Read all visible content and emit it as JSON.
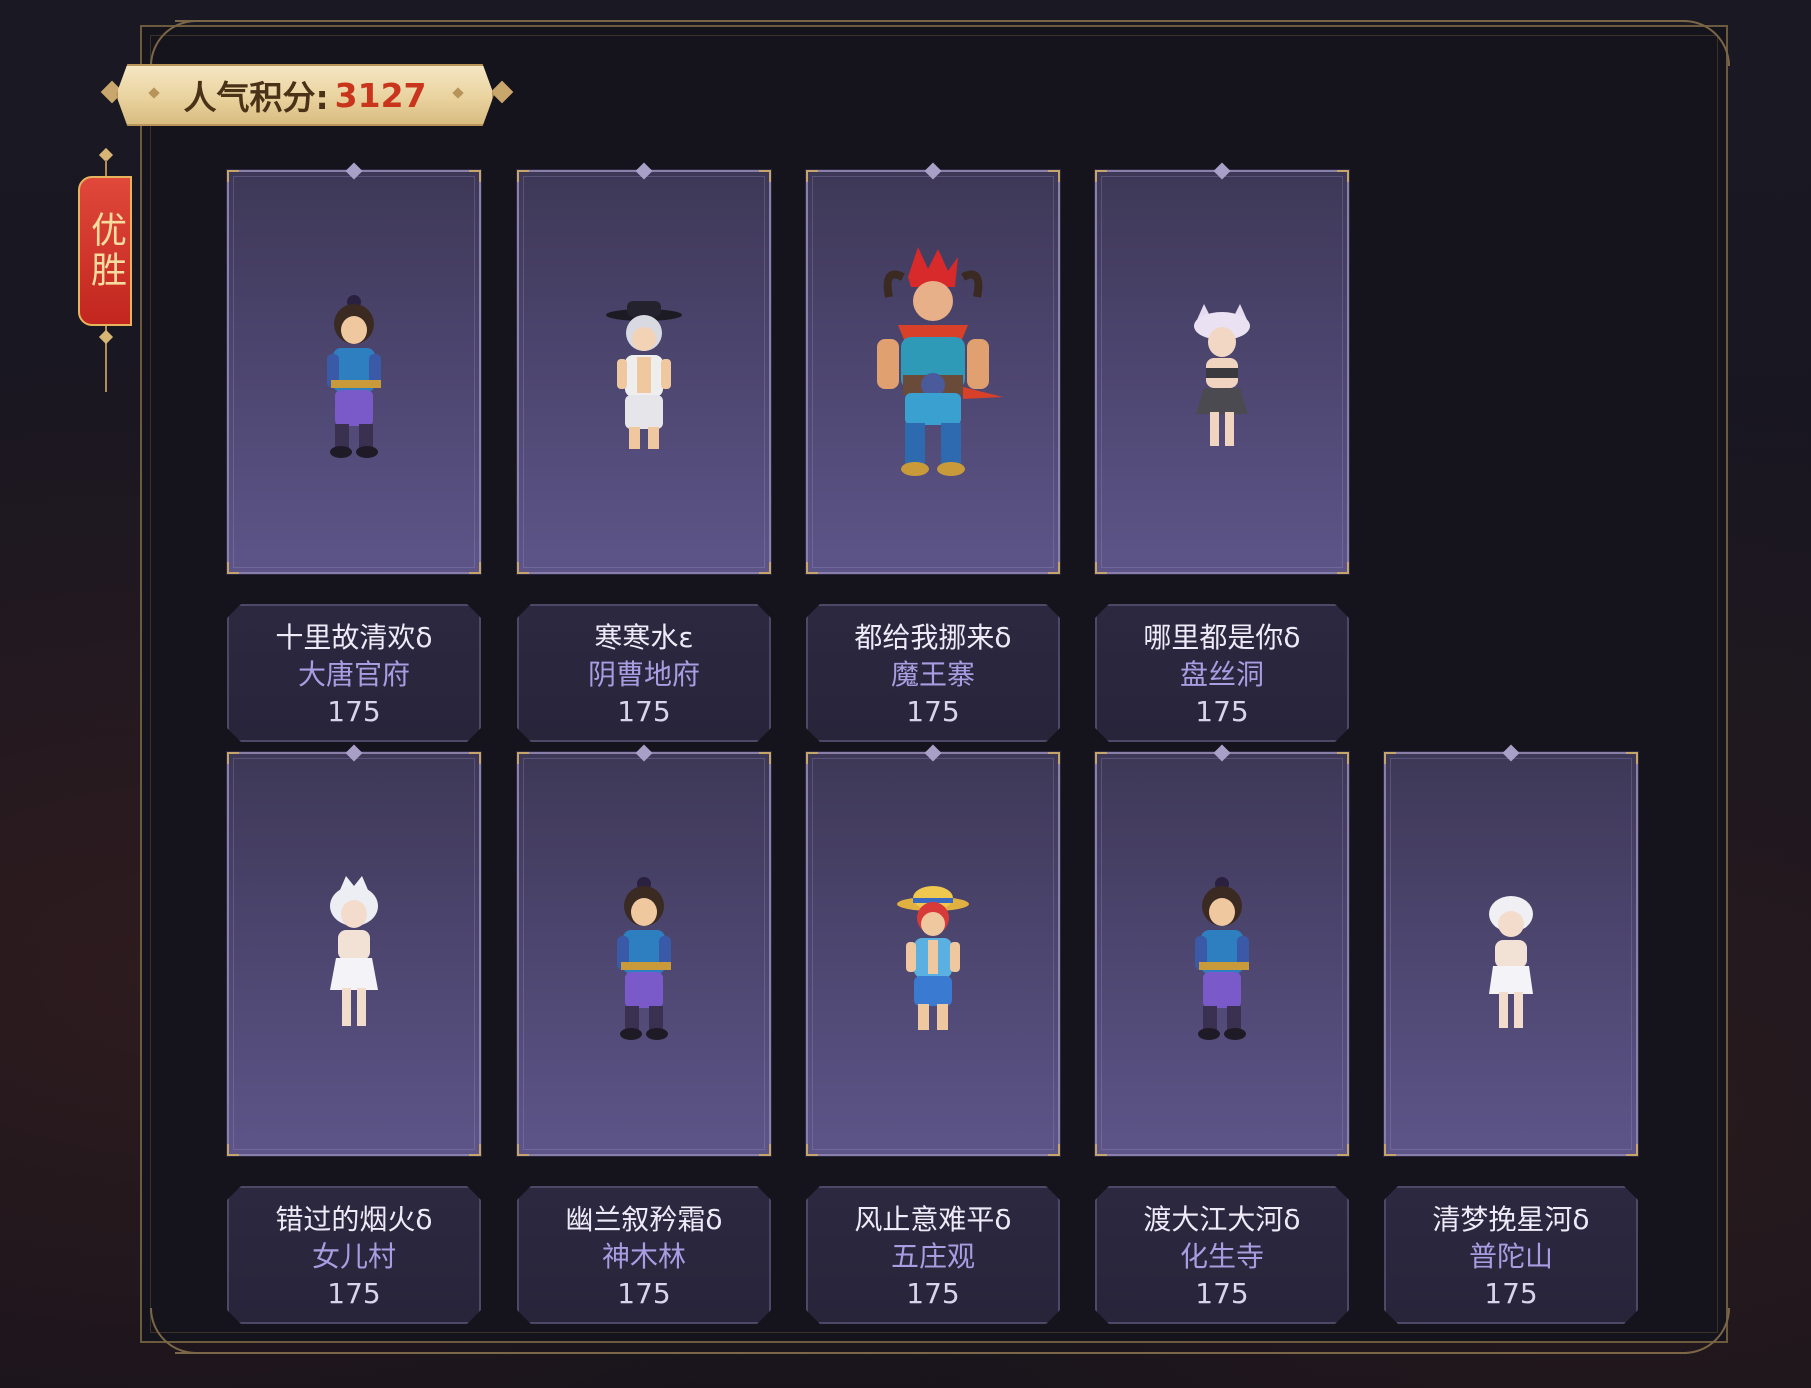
{
  "score": {
    "label": "人气积分:",
    "value": "3127"
  },
  "side_tag": {
    "text": "优胜"
  },
  "colors": {
    "accent_gold": "#c5a56a",
    "score_value": "#c8351c",
    "school_text": "#a79de0",
    "tag_red": "#c2261f"
  },
  "players": [
    {
      "name": "十里故清欢δ",
      "school": "大唐官府",
      "level": "175",
      "sprite": "swordsman-blue-topknot"
    },
    {
      "name": "寒寒水ε",
      "school": "阴曹地府",
      "level": "175",
      "sprite": "white-haired-boy-black-hat"
    },
    {
      "name": "都给我挪来δ",
      "school": "魔王寨",
      "level": "175",
      "sprite": "red-haired-horned-warrior"
    },
    {
      "name": "哪里都是你δ",
      "school": "盘丝洞",
      "level": "175",
      "sprite": "cat-eared-girl"
    },
    {
      "name": "错过的烟火δ",
      "school": "女儿村",
      "level": "175",
      "sprite": "white-dress-girl"
    },
    {
      "name": "幽兰叙矜霜δ",
      "school": "神木林",
      "level": "175",
      "sprite": "swordsman-blue-topknot"
    },
    {
      "name": "风止意难平δ",
      "school": "五庄观",
      "level": "175",
      "sprite": "straw-hat-boy"
    },
    {
      "name": "渡大江大河δ",
      "school": "化生寺",
      "level": "175",
      "sprite": "swordsman-blue-topknot"
    },
    {
      "name": "清梦挽星河δ",
      "school": "普陀山",
      "level": "175",
      "sprite": "white-haired-girl"
    }
  ]
}
